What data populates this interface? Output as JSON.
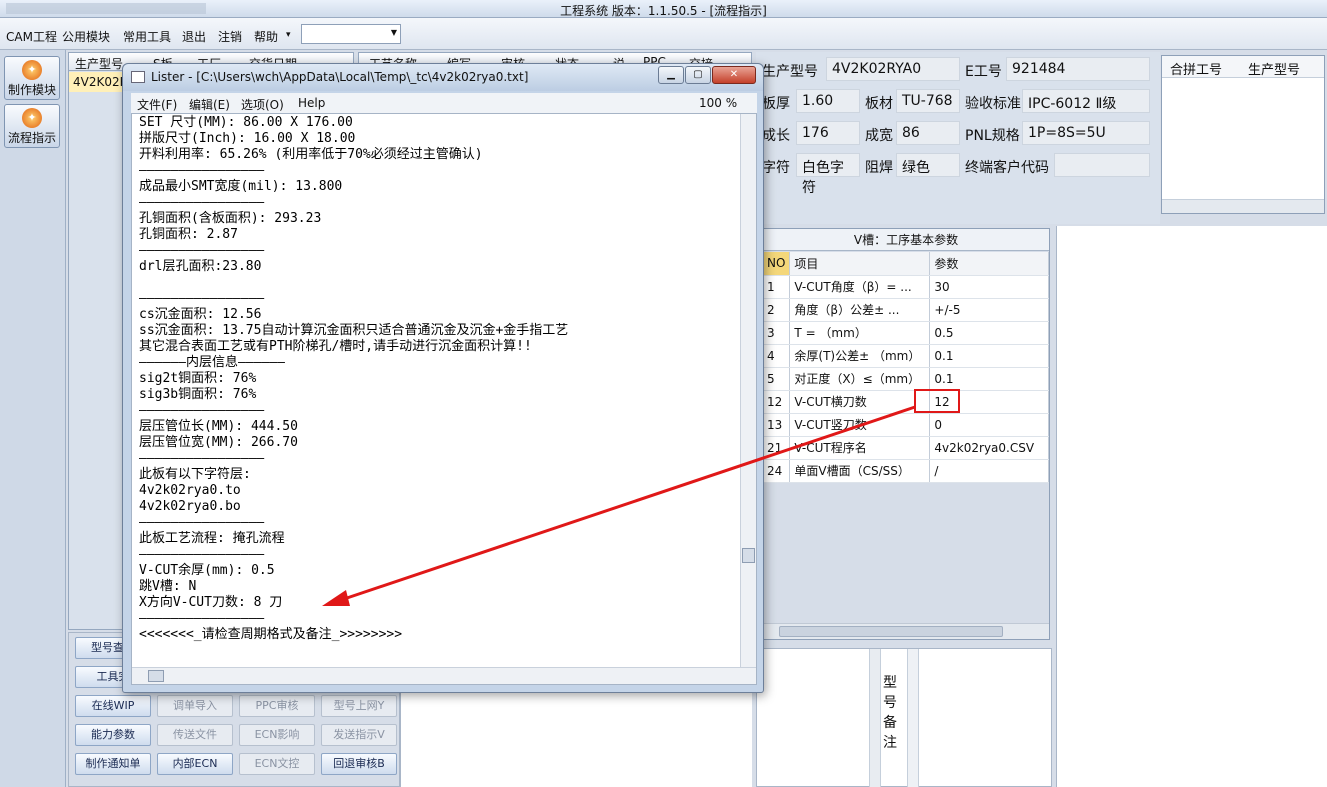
{
  "app": {
    "title": "工程系统    版本：1.1.50.5 - [流程指示]"
  },
  "menubar": {
    "items": [
      "CAM工程",
      "公用模块",
      "常用工具",
      "退出",
      "注销",
      "帮助"
    ]
  },
  "leftnav": {
    "items": [
      {
        "label": "制作模块",
        "active": false
      },
      {
        "label": "流程指示",
        "active": true
      }
    ]
  },
  "grid1": {
    "headers": [
      "生产型号",
      "S板",
      "工厂",
      "交货日期"
    ],
    "rows": [
      "4V2K02RYA0"
    ]
  },
  "grid2": {
    "headers": [
      "工艺名称",
      "编写",
      "审核",
      "状态",
      "说",
      "PPC",
      "交接"
    ]
  },
  "buttons": {
    "col1": [
      "型号查询",
      "工具完",
      "在线WIP",
      "能力参数",
      "制作通知单"
    ],
    "col2": [
      "调单导入",
      "传送文件",
      "内部ECN"
    ],
    "col3": [
      "PPC审核",
      "ECN影响",
      "ECN文控"
    ],
    "col4": [
      "型号上网Y",
      "发送指示V",
      "回退审核B"
    ]
  },
  "info": {
    "prod_no_label": "生产型号",
    "prod_no": "4V2K02RYA0",
    "e_no_label": "E工号",
    "e_no": "921484",
    "thickness_label": "板厚",
    "thickness": "1.60",
    "material_label": "板材",
    "material": "TU-768",
    "standard_label": "验收标准",
    "standard": "IPC-6012 Ⅱ级",
    "length_label": "成长",
    "length": "176",
    "width_label": "成宽",
    "width": "86",
    "pnl_label": "PNL规格",
    "pnl": "1P=8S=5U",
    "char_label": "字符",
    "char": "白色字符",
    "mask_label": "阻焊",
    "mask": "绿色",
    "customer_label": "终端客户代码",
    "customer": ""
  },
  "merge": {
    "headers": [
      "合拼工号",
      "生产型号"
    ]
  },
  "vgroove": {
    "caption": "V槽：工序基本参数",
    "headers": [
      "NO",
      "项目",
      "参数"
    ],
    "rows": [
      {
        "no": "1",
        "item": "V-CUT角度（β）=  ...",
        "param": "30"
      },
      {
        "no": "2",
        "item": "角度（β）公差±  ...",
        "param": "+/-5"
      },
      {
        "no": "3",
        "item": "T =  （mm）",
        "param": "0.5"
      },
      {
        "no": "4",
        "item": "余厚(T)公差±  （mm）",
        "param": "0.1"
      },
      {
        "no": "5",
        "item": "对正度（X）≤（mm）",
        "param": "0.1"
      },
      {
        "no": "12",
        "item": "V-CUT横刀数",
        "param": "12"
      },
      {
        "no": "13",
        "item": "V-CUT竖刀数",
        "param": "0"
      },
      {
        "no": "21",
        "item": "V-CUT程序名",
        "param": "4v2k02rya0.CSV"
      },
      {
        "no": "24",
        "item": "单面V槽面（CS/SS）",
        "param": "/"
      }
    ]
  },
  "memo": {
    "label": "型号备注"
  },
  "lister": {
    "title": "Lister - [C:\\Users\\wch\\AppData\\Local\\Temp\\_tc\\4v2k02rya0.txt]",
    "menu": [
      "文件(F)",
      "编辑(E)",
      "选项(O)",
      "Help"
    ],
    "zoom": "100 %",
    "lines": [
      "SET 尺寸(MM): 86.00 X 176.00",
      "拼版尺寸(Inch): 16.00 X 18.00",
      "开料利用率: 65.26% (利用率低于70%必须经过主管确认)",
      "————————————————",
      "成品最小SMT宽度(mil): 13.800",
      "————————————————",
      "孔铜面积(含板面积): 293.23",
      "孔铜面积: 2.87",
      "————————————————",
      "drl层孔面积:23.80",
      "",
      "————————————————",
      "cs沉金面积: 12.56",
      "ss沉金面积: 13.75自动计算沉金面积只适合普通沉金及沉金+金手指工艺",
      "其它混合表面工艺或有PTH阶梯孔/槽时,请手动进行沉金面积计算!!",
      "——————内层信息——————",
      "sig2t铜面积: 76%",
      "sig3b铜面积: 76%",
      "————————————————",
      "层压管位长(MM): 444.50",
      "层压管位宽(MM): 266.70",
      "————————————————",
      "此板有以下字符层:",
      "4v2k02rya0.to",
      "4v2k02rya0.bo",
      "————————————————",
      "此板工艺流程: 掩孔流程",
      "————————————————",
      "V-CUT余厚(mm): 0.5",
      "跳V槽: N",
      "X方向V-CUT刀数: 8 刀",
      "————————————————",
      "<<<<<<<_请检查周期格式及备注_>>>>>>>>"
    ]
  }
}
